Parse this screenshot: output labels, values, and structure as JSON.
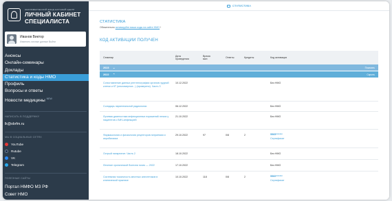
{
  "sidebar": {
    "org": "НЕКОММЕРЧЕСКИЙ ФОНД НАУЧНЫЙ ЦЕНТР",
    "title_line1": "ЛИЧНЫЙ КАБИНЕТ",
    "title_line2": "СПЕЦИАЛИСТА",
    "user_name": "Иванов Виктор",
    "user_sub": "Изменить личные данные   Выйти",
    "nav": [
      {
        "label": "Анонсы"
      },
      {
        "label": "Онлайн-семинары"
      },
      {
        "label": "Доклады"
      },
      {
        "label": "Статистика и коды НМО"
      },
      {
        "label": "Профиль"
      },
      {
        "label": "Вопросы и ответы"
      },
      {
        "label": "Новости медицины",
        "badge": "NEW"
      }
    ],
    "support_heading": "НАПИСАТЬ В ПОДДЕРЖКУ",
    "support_email": "lk@obrfm.ru",
    "social_heading": "МЫ В СОЦИАЛЬНЫХ СЕТЯХ",
    "social": [
      {
        "label": "YouTube",
        "color": "#e53935"
      },
      {
        "label": "Rutube",
        "color": "#1b2a4a"
      },
      {
        "label": "VK",
        "color": "#2787f5"
      },
      {
        "label": "Telegram",
        "color": "#29a9eb"
      }
    ],
    "sites_heading": "ПОЛЕЗНЫЕ САЙТЫ",
    "sites": [
      "Портал НМФО МЗ РФ",
      "Совет НМО"
    ]
  },
  "topbar": {
    "tab": "СТАТИСТИКА"
  },
  "page": {
    "title": "СТАТИСТИКА",
    "subtitle_prefix": "Обязательно ",
    "subtitle_link": "активируйте ваши коды на сайте НМО",
    "subtitle_suffix": " !",
    "section": "КОД АКТИВАЦИИ ПОЛУЧЕН"
  },
  "table": {
    "headers": [
      "Семинар",
      "Дата проведения",
      "Время мин",
      "Ответы",
      "Кредиты",
      "Код активации"
    ],
    "years": [
      {
        "label": "2023",
        "right": "Показать"
      },
      {
        "label": "2022",
        "right": "Скрыть"
      }
    ],
    "rows": [
      {
        "title": "Сопоставление данных рентгенографии органов грудной клетки и КТ (многомерное...) (проверено). Часть 3",
        "date": "10.12.2022",
        "time": "",
        "answers": "",
        "credits": "",
        "code": "Без НМО",
        "sert": ""
      },
      {
        "title": "Солидарь ларингеальной радиологии",
        "date": "06.12.2022",
        "time": "",
        "answers": "",
        "credits": "",
        "code": "Без НМО",
        "sert": ""
      },
      {
        "title": "Лучевая диагностика инфекционных поражений легких у пациентов с ВИЧ-инфекцией",
        "date": "21.10.2022",
        "time": "",
        "answers": "",
        "credits": "",
        "code": "Без НМО",
        "sert": ""
      },
      {
        "title": "Фармакология и физиология рецепторов натриемии и аэробиозиса",
        "date": "29.10.2022",
        "time": "97",
        "answers": "0/8",
        "credits": "2",
        "code": "5565*******",
        "sert": "Сертификат"
      },
      {
        "title": "Острый панкреатит. Часть 2",
        "date": "18.10.2022",
        "time": "",
        "answers": "",
        "credits": "",
        "code": "Без НМО",
        "sert": ""
      },
      {
        "title": "Лечение хронической болезни почек — 2022",
        "date": "17.10.2022",
        "time": "",
        "answers": "",
        "credits": "",
        "code": "Без НМО",
        "sert": ""
      },
      {
        "title": "Системная токсичность местных анестетиков в клинической практике",
        "date": "10.10.2022",
        "time": "118",
        "answers": "0/8",
        "credits": "2",
        "code": "5560*******",
        "sert": "Сертификат"
      }
    ]
  },
  "colors": {
    "sidebar": "#2c3b4a",
    "accent": "#3a9ed9",
    "yearbar": "#80b8de"
  }
}
